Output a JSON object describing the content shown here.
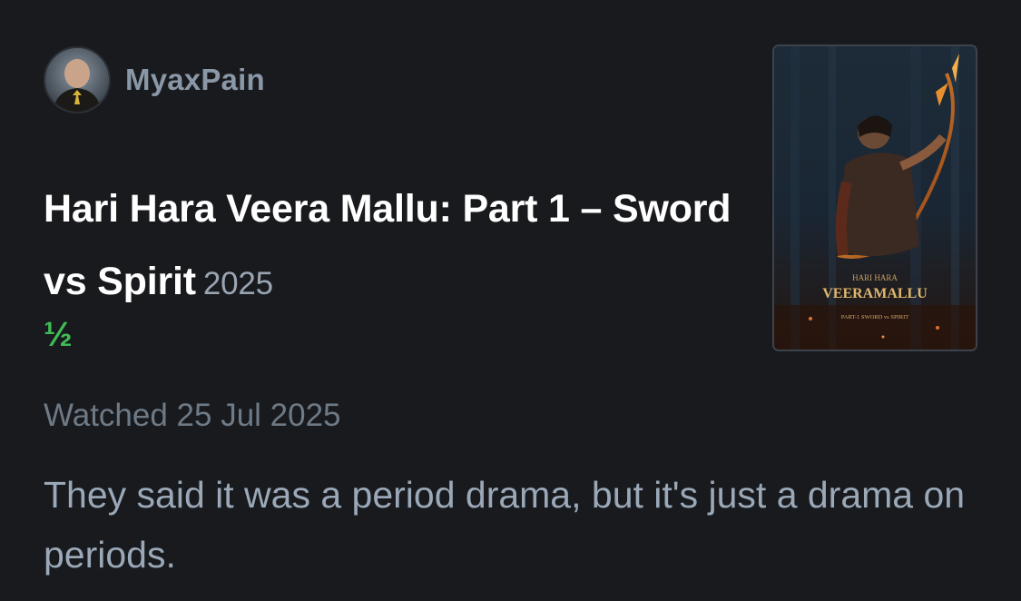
{
  "author": {
    "name": "MyaxPain",
    "avatar_icon": "user-avatar-icon"
  },
  "film": {
    "title": "Hari Hara Veera Mallu: Part 1 – Sword vs Spirit",
    "year": "2025",
    "poster": {
      "tagline_top": "HARI HARA",
      "title": "VEERAMALLU",
      "subtitle": "PART-1 SWORD vs SPIRIT"
    }
  },
  "review": {
    "rating": "½",
    "watched": "Watched 25 Jul 2025",
    "text": "They said it was a period drama, but it's just a drama on periods."
  },
  "colors": {
    "background": "#181a1e",
    "rating_green": "#40bc56",
    "title_white": "#ffffff",
    "muted_text": "#9aa8b8"
  }
}
